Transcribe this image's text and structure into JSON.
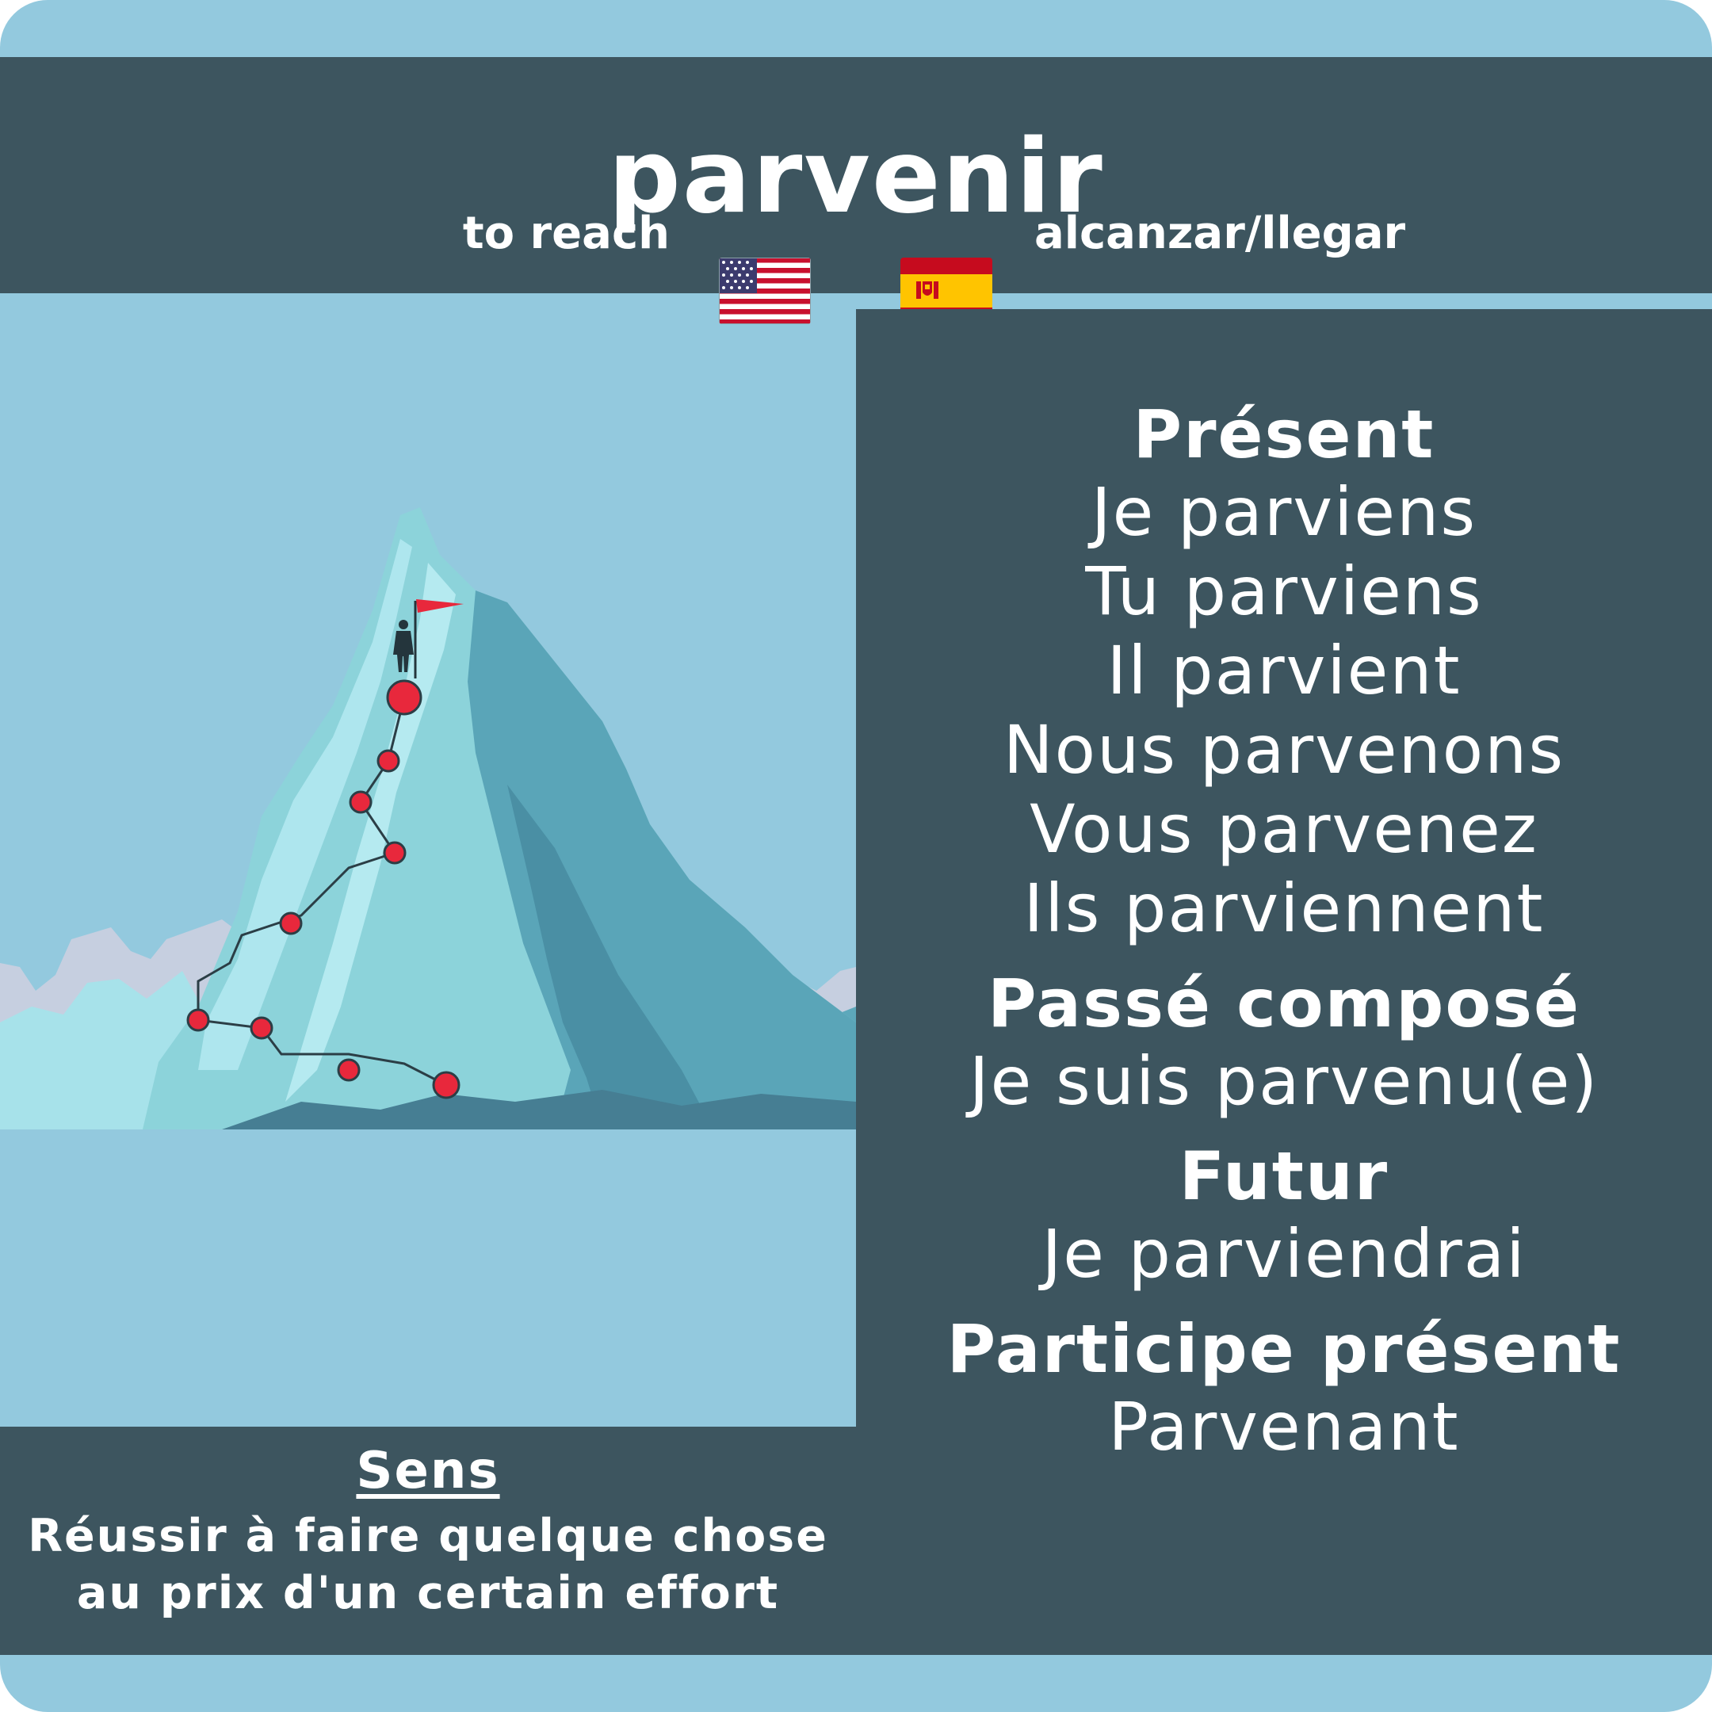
{
  "verb": "parvenir",
  "translations": {
    "english": "to reach",
    "spanish": "alcanzar/llegar"
  },
  "flags": {
    "english": "us-flag-icon",
    "spanish": "spain-flag-icon"
  },
  "conjugation": {
    "present": {
      "title": "Présent",
      "forms": [
        "Je parviens",
        "Tu parviens",
        "Il parvient",
        "Nous parvenons",
        "Vous parvenez",
        "Ils parviennent"
      ]
    },
    "passe_compose": {
      "title": "Passé composé",
      "form": "Je suis parvenu(e)"
    },
    "futur": {
      "title": "Futur",
      "form": "Je parviendrai"
    },
    "participe_present": {
      "title": "Participe présent",
      "form": "Parvenant"
    }
  },
  "meaning": {
    "title": "Sens",
    "text": "Réussir à faire quelque chose au prix d'un certain effort"
  },
  "illustration": "mountain-summit-climber-icon",
  "colors": {
    "background": "#93c9de",
    "panel": "#3d555f",
    "text": "#ffffff",
    "accent": "#e8283c"
  }
}
